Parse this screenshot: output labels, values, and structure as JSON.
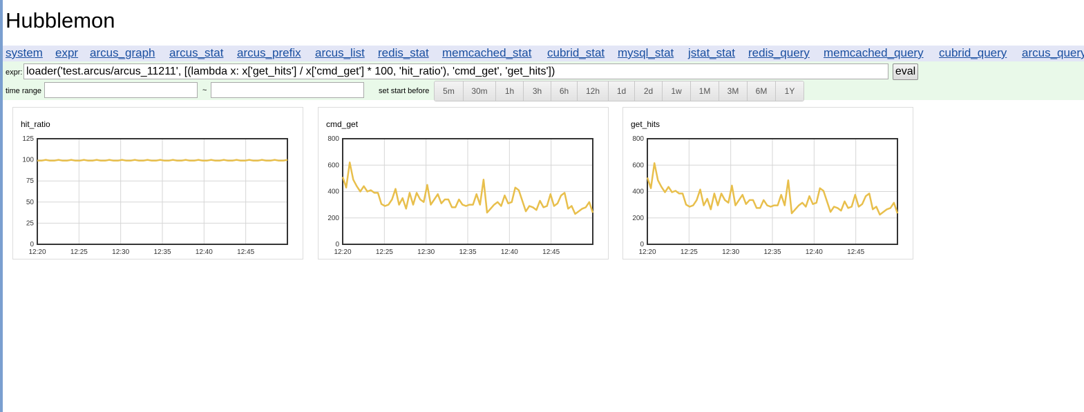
{
  "app": {
    "title": "Hubblemon"
  },
  "nav": {
    "links": [
      "system",
      "expr",
      "arcus_graph",
      "arcus_stat",
      "arcus_prefix",
      "arcus_list",
      "redis_stat",
      "memcached_stat",
      "cubrid_stat",
      "mysql_stat",
      "jstat_stat",
      "redis_query",
      "memcached_query",
      "cubrid_query",
      "arcus_query"
    ]
  },
  "controls": {
    "expr_label": "expr:",
    "expr_value": "loader('test.arcus/arcus_11211', [(lambda x: x['get_hits'] / x['cmd_get'] * 100, 'hit_ratio'), 'cmd_get', 'get_hits'])",
    "eval_label": "eval",
    "time_range_label": "time range",
    "time_start_value": "",
    "time_end_value": "",
    "range_separator": "~",
    "set_start_label": "set start before",
    "range_buttons": [
      "5m",
      "30m",
      "1h",
      "3h",
      "6h",
      "12h",
      "1d",
      "2d",
      "1w",
      "1M",
      "3M",
      "6M",
      "1Y"
    ]
  },
  "colors": {
    "series": "#e8bf4c",
    "nav_bg": "#e3e6f6",
    "controls_bg": "#e9f9e9",
    "link": "#1a4fa0"
  },
  "chart_data": [
    {
      "type": "line",
      "title": "hit_ratio",
      "x": [
        "12:20",
        "12:20:30",
        "12:21",
        "12:21:30",
        "12:22",
        "12:22:30",
        "12:23",
        "12:23:30",
        "12:24",
        "12:24:30",
        "12:25",
        "12:25:30",
        "12:26",
        "12:26:30",
        "12:27",
        "12:27:30",
        "12:28",
        "12:28:30",
        "12:29",
        "12:29:30",
        "12:30",
        "12:30:30",
        "12:31",
        "12:31:30",
        "12:32",
        "12:32:30",
        "12:33",
        "12:33:30",
        "12:34",
        "12:34:30",
        "12:35",
        "12:35:30",
        "12:36",
        "12:36:30",
        "12:37",
        "12:37:30",
        "12:38",
        "12:38:30",
        "12:39",
        "12:39:30",
        "12:40",
        "12:40:30",
        "12:41",
        "12:41:30",
        "12:42",
        "12:42:30",
        "12:43",
        "12:43:30",
        "12:44",
        "12:44:30",
        "12:45",
        "12:45:30",
        "12:46",
        "12:46:30",
        "12:47",
        "12:47:30",
        "12:48",
        "12:48:30",
        "12:49",
        "12:49:30"
      ],
      "xticks": [
        "12:20",
        "12:25",
        "12:30",
        "12:35",
        "12:40",
        "12:45"
      ],
      "series": [
        {
          "name": "hit_ratio",
          "values": [
            99,
            99,
            100,
            99,
            99,
            100,
            99,
            99,
            100,
            99,
            99,
            100,
            99,
            99,
            100,
            99,
            99,
            100,
            99,
            99,
            100,
            99,
            99,
            100,
            99,
            99,
            100,
            99,
            99,
            100,
            99,
            99,
            100,
            99,
            99,
            100,
            99,
            99,
            100,
            99,
            99,
            100,
            99,
            99,
            100,
            99,
            99,
            100,
            99,
            99,
            100,
            99,
            99,
            100,
            99,
            99,
            100,
            99,
            99,
            100
          ]
        }
      ],
      "yticks": [
        "0",
        "25",
        "50",
        "75",
        "100",
        "125"
      ],
      "ylim": [
        0,
        125
      ],
      "grid": true
    },
    {
      "type": "line",
      "title": "cmd_get",
      "x": [
        "12:20",
        "12:20:30",
        "12:21",
        "12:21:30",
        "12:22",
        "12:22:30",
        "12:23",
        "12:23:30",
        "12:24",
        "12:24:30",
        "12:25",
        "12:25:30",
        "12:26",
        "12:26:30",
        "12:27",
        "12:27:30",
        "12:28",
        "12:28:30",
        "12:29",
        "12:29:30",
        "12:30",
        "12:30:30",
        "12:31",
        "12:31:30",
        "12:32",
        "12:32:30",
        "12:33",
        "12:33:30",
        "12:34",
        "12:34:30",
        "12:35",
        "12:35:30",
        "12:36",
        "12:36:30",
        "12:37",
        "12:37:30",
        "12:38",
        "12:38:30",
        "12:39",
        "12:39:30",
        "12:40",
        "12:40:30",
        "12:41",
        "12:41:30",
        "12:42",
        "12:42:30",
        "12:43",
        "12:43:30",
        "12:44",
        "12:44:30",
        "12:45",
        "12:45:30",
        "12:46",
        "12:46:30",
        "12:47",
        "12:47:30",
        "12:48",
        "12:48:30",
        "12:49",
        "12:49:30"
      ],
      "xticks": [
        "12:20",
        "12:25",
        "12:30",
        "12:35",
        "12:40",
        "12:45"
      ],
      "series": [
        {
          "name": "cmd_get",
          "values": [
            510,
            430,
            620,
            490,
            440,
            400,
            440,
            400,
            410,
            390,
            390,
            305,
            290,
            300,
            340,
            420,
            300,
            350,
            270,
            390,
            300,
            390,
            340,
            320,
            450,
            300,
            340,
            380,
            310,
            340,
            340,
            280,
            280,
            340,
            300,
            290,
            300,
            300,
            380,
            300,
            490,
            240,
            270,
            300,
            320,
            290,
            370,
            310,
            320,
            430,
            410,
            330,
            250,
            290,
            280,
            260,
            330,
            280,
            290,
            380,
            290,
            310,
            370,
            390,
            270,
            290,
            230,
            250,
            270,
            280,
            320,
            240
          ]
        }
      ],
      "yticks": [
        "0",
        "200",
        "400",
        "600",
        "800"
      ],
      "ylim": [
        0,
        800
      ],
      "grid": true
    },
    {
      "type": "line",
      "title": "get_hits",
      "x": [
        "12:20",
        "12:20:30",
        "12:21",
        "12:21:30",
        "12:22",
        "12:22:30",
        "12:23",
        "12:23:30",
        "12:24",
        "12:24:30",
        "12:25",
        "12:25:30",
        "12:26",
        "12:26:30",
        "12:27",
        "12:27:30",
        "12:28",
        "12:28:30",
        "12:29",
        "12:29:30",
        "12:30",
        "12:30:30",
        "12:31",
        "12:31:30",
        "12:32",
        "12:32:30",
        "12:33",
        "12:33:30",
        "12:34",
        "12:34:30",
        "12:35",
        "12:35:30",
        "12:36",
        "12:36:30",
        "12:37",
        "12:37:30",
        "12:38",
        "12:38:30",
        "12:39",
        "12:39:30",
        "12:40",
        "12:40:30",
        "12:41",
        "12:41:30",
        "12:42",
        "12:42:30",
        "12:43",
        "12:43:30",
        "12:44",
        "12:44:30",
        "12:45",
        "12:45:30",
        "12:46",
        "12:46:30",
        "12:47",
        "12:47:30",
        "12:48",
        "12:48:30",
        "12:49",
        "12:49:30"
      ],
      "xticks": [
        "12:20",
        "12:25",
        "12:30",
        "12:35",
        "12:40",
        "12:45"
      ],
      "series": [
        {
          "name": "get_hits",
          "values": [
            505,
            425,
            615,
            485,
            435,
            395,
            435,
            395,
            405,
            385,
            385,
            300,
            285,
            295,
            335,
            415,
            295,
            345,
            265,
            385,
            295,
            385,
            335,
            315,
            445,
            295,
            335,
            375,
            305,
            335,
            335,
            275,
            275,
            335,
            295,
            285,
            295,
            295,
            375,
            295,
            485,
            235,
            265,
            295,
            315,
            285,
            365,
            305,
            315,
            425,
            405,
            325,
            245,
            285,
            275,
            255,
            325,
            275,
            285,
            375,
            285,
            305,
            365,
            385,
            265,
            285,
            225,
            245,
            265,
            275,
            315,
            235
          ]
        }
      ],
      "yticks": [
        "0",
        "200",
        "400",
        "600",
        "800"
      ],
      "ylim": [
        0,
        800
      ],
      "grid": true
    }
  ]
}
